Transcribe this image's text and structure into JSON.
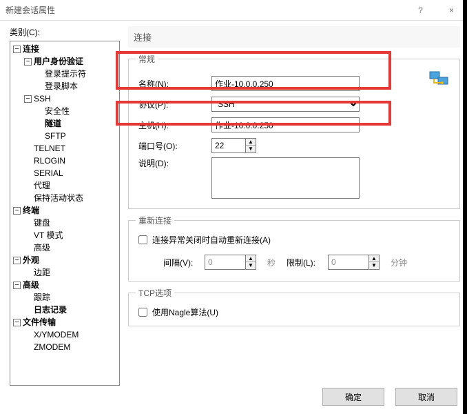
{
  "window": {
    "title": "新建会话属性",
    "help": "?",
    "close": "×"
  },
  "tree_label": "类别(C):",
  "tree": {
    "connection": "连接",
    "user_auth": "用户身份验证",
    "login_prompt": "登录提示符",
    "login_script": "登录脚本",
    "ssh": "SSH",
    "security": "安全性",
    "tunnel": "隧道",
    "sftp": "SFTP",
    "telnet": "TELNET",
    "rlogin": "RLOGIN",
    "serial": "SERIAL",
    "proxy": "代理",
    "keepalive": "保持活动状态",
    "terminal": "终端",
    "keyboard": "键盘",
    "vt": "VT 模式",
    "advanced_term": "高级",
    "appearance": "外观",
    "margin": "边距",
    "advanced": "高级",
    "trace": "跟踪",
    "logging": "日志记录",
    "file_transfer": "文件传输",
    "xymodem": "X/YMODEM",
    "zmodem": "ZMODEM"
  },
  "panel": {
    "heading": "连接",
    "group_general": "常规",
    "name_label": "名称(N):",
    "name_value": "作业-10.0.0.250",
    "protocol_label": "协议(P):",
    "protocol_value": "SSH",
    "host_label": "主机(H):",
    "host_value": "作业-10.0.0.250",
    "port_label": "端口号(O):",
    "port_value": "22",
    "desc_label": "说明(D):",
    "desc_value": "",
    "group_reconnect": "重新连接",
    "reconnect_chk": "连接异常关闭时自动重新连接(A)",
    "interval_label": "间隔(V):",
    "interval_value": "0",
    "seconds": "秒",
    "limit_label": "限制(L):",
    "limit_value": "0",
    "minutes": "分钟",
    "group_tcp": "TCP选项",
    "nagle_chk": "使用Nagle算法(U)"
  },
  "buttons": {
    "ok": "确定",
    "cancel": "取消"
  }
}
